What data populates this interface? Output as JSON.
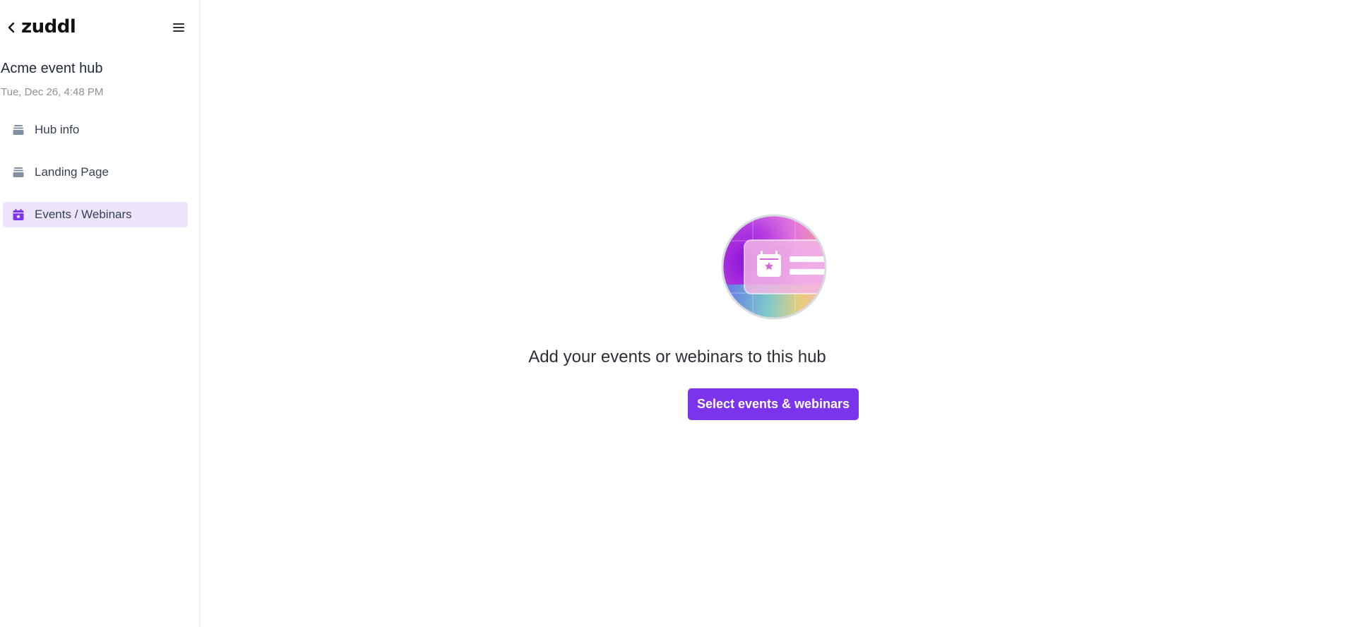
{
  "app": {
    "logo_text": "zuddl",
    "back_icon": "chevron-left-icon",
    "menu_icon": "hamburger-menu-icon"
  },
  "hub": {
    "title": "Acme event hub",
    "date": "Tue, Dec 26, 4:48 PM"
  },
  "sidebar": {
    "items": [
      {
        "label": "Hub info",
        "icon": "stack-icon",
        "active": false
      },
      {
        "label": "Landing Page",
        "icon": "stack-icon",
        "active": false
      },
      {
        "label": "Events / Webinars",
        "icon": "calendar-star-icon",
        "active": true
      }
    ]
  },
  "main": {
    "illustration_icon": "calendar-card-illustration",
    "empty_message": "Add your events or webinars to this hub",
    "cta_label": "Select events & webinars"
  },
  "colors": {
    "accent": "#7b33ec",
    "active_bg": "#ede4fc",
    "muted_text": "#8b929a",
    "nav_icon_inactive": "#8090a0"
  }
}
